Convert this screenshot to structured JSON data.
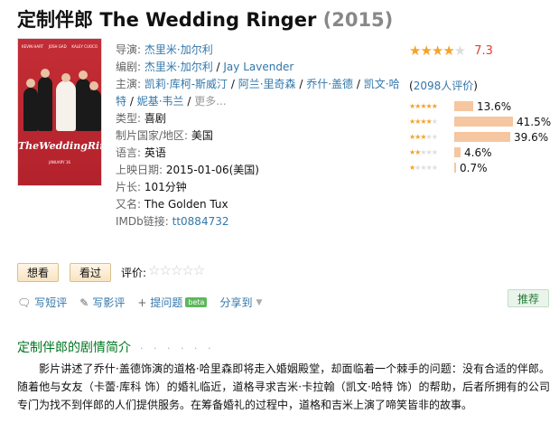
{
  "title": {
    "cn": "定制伴郎",
    "en": "The Wedding Ringer",
    "year": "(2015)"
  },
  "poster": {
    "names": [
      "KEVIN HART",
      "JOSH GAD",
      "KALEY CUOCO"
    ],
    "title": "TheWeddingRinger",
    "date": "JANUARY 16"
  },
  "info": {
    "director_label": "导演:",
    "director": "杰里米·加尔利",
    "writer_label": "编剧:",
    "writers": [
      "杰里米·加尔利",
      "Jay Lavender"
    ],
    "cast_label": "主演:",
    "cast": [
      "凯莉·库柯-斯威汀",
      "阿兰·里奇森",
      "乔什·盖德",
      "凯文·哈特",
      "妮基·韦兰"
    ],
    "more": "更多...",
    "genre_label": "类型:",
    "genre": "喜剧",
    "country_label": "制片国家/地区:",
    "country": "美国",
    "language_label": "语言:",
    "language": "英语",
    "release_label": "上映日期:",
    "release": "2015-01-06(美国)",
    "runtime_label": "片长:",
    "runtime": "101分钟",
    "aka_label": "又名:",
    "aka": "The Golden Tux",
    "imdb_label": "IMDb链接:",
    "imdb": "tt0884732"
  },
  "rating": {
    "score": "7.3",
    "stars_filled": 4,
    "count_open": "(",
    "count": "2098人评价",
    "count_close": ")",
    "breakdown": [
      {
        "stars": 5,
        "percent": "13.6%",
        "value": 13.6
      },
      {
        "stars": 4,
        "percent": "41.5%",
        "value": 41.5
      },
      {
        "stars": 3,
        "percent": "39.6%",
        "value": 39.6
      },
      {
        "stars": 2,
        "percent": "4.6%",
        "value": 4.6
      },
      {
        "stars": 1,
        "percent": "0.7%",
        "value": 0.7
      }
    ],
    "star_color": "#f4a32b",
    "bar_color": "#f5c6a0"
  },
  "buttons": {
    "want": "想看",
    "seen": "看过",
    "rate_label": "评价:"
  },
  "actions": {
    "short_review": "写短评",
    "review": "写影评",
    "question": "提问题",
    "beta": "beta",
    "share": "分享到",
    "recommend": "推荐"
  },
  "summary": {
    "heading": "定制伴郎的剧情简介",
    "dots": "· · · · · ·",
    "text": "影片讲述了乔什·盖德饰演的道格·哈里森即将走入婚姻殿堂，却面临着一个棘手的问题：没有合适的伴郎。随着他与女友（卡蕾·库科 饰）的婚礼临近，道格寻求吉米·卡拉翰（凯文·哈特 饰）的帮助，后者所拥有的公司专门为找不到伴郎的人们提供服务。在筹备婚礼的过程中，道格和吉米上演了啼笑皆非的故事。"
  }
}
